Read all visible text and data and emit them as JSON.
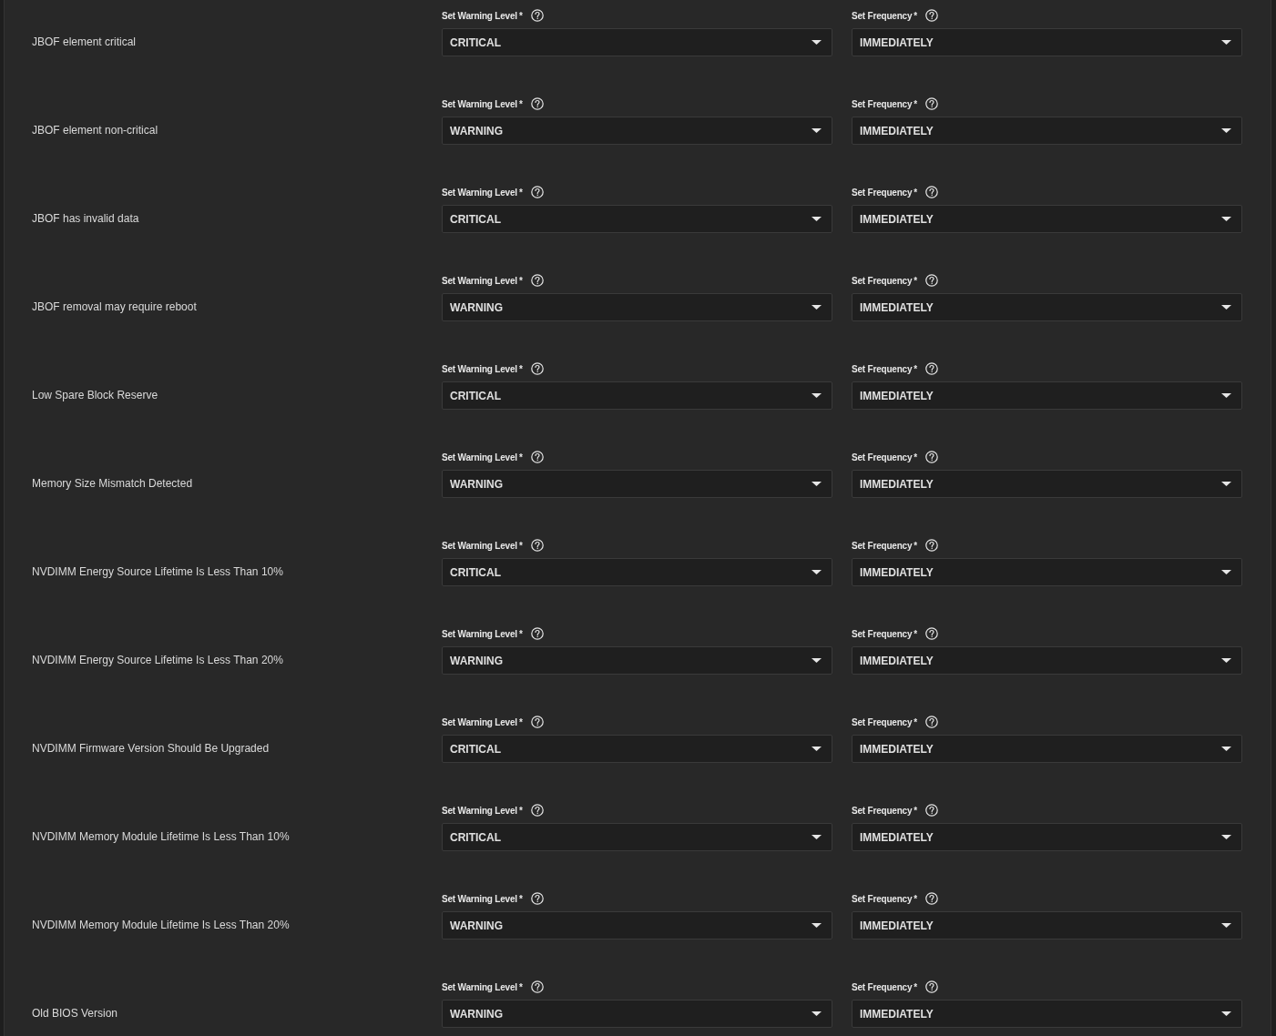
{
  "alerts": [
    {
      "name": "JBOF element critical",
      "level": {
        "label": "Set Warning Level",
        "required_mark": "*",
        "value": "CRITICAL"
      },
      "frequency": {
        "label": "Set Frequency",
        "required_mark": "*",
        "value": "IMMEDIATELY"
      }
    },
    {
      "name": "JBOF element non-critical",
      "level": {
        "label": "Set Warning Level",
        "required_mark": "*",
        "value": "WARNING"
      },
      "frequency": {
        "label": "Set Frequency",
        "required_mark": "*",
        "value": "IMMEDIATELY"
      }
    },
    {
      "name": "JBOF has invalid data",
      "level": {
        "label": "Set Warning Level",
        "required_mark": "*",
        "value": "CRITICAL"
      },
      "frequency": {
        "label": "Set Frequency",
        "required_mark": "*",
        "value": "IMMEDIATELY"
      }
    },
    {
      "name": "JBOF removal may require reboot",
      "level": {
        "label": "Set Warning Level",
        "required_mark": "*",
        "value": "WARNING"
      },
      "frequency": {
        "label": "Set Frequency",
        "required_mark": "*",
        "value": "IMMEDIATELY"
      }
    },
    {
      "name": "Low Spare Block Reserve",
      "level": {
        "label": "Set Warning Level",
        "required_mark": "*",
        "value": "CRITICAL"
      },
      "frequency": {
        "label": "Set Frequency",
        "required_mark": "*",
        "value": "IMMEDIATELY"
      }
    },
    {
      "name": "Memory Size Mismatch Detected",
      "level": {
        "label": "Set Warning Level",
        "required_mark": "*",
        "value": "WARNING"
      },
      "frequency": {
        "label": "Set Frequency",
        "required_mark": "*",
        "value": "IMMEDIATELY"
      }
    },
    {
      "name": "NVDIMM Energy Source Lifetime Is Less Than 10%",
      "level": {
        "label": "Set Warning Level",
        "required_mark": "*",
        "value": "CRITICAL"
      },
      "frequency": {
        "label": "Set Frequency",
        "required_mark": "*",
        "value": "IMMEDIATELY"
      }
    },
    {
      "name": "NVDIMM Energy Source Lifetime Is Less Than 20%",
      "level": {
        "label": "Set Warning Level",
        "required_mark": "*",
        "value": "WARNING"
      },
      "frequency": {
        "label": "Set Frequency",
        "required_mark": "*",
        "value": "IMMEDIATELY"
      }
    },
    {
      "name": "NVDIMM Firmware Version Should Be Upgraded",
      "level": {
        "label": "Set Warning Level",
        "required_mark": "*",
        "value": "CRITICAL"
      },
      "frequency": {
        "label": "Set Frequency",
        "required_mark": "*",
        "value": "IMMEDIATELY"
      }
    },
    {
      "name": "NVDIMM Memory Module Lifetime Is Less Than 10%",
      "level": {
        "label": "Set Warning Level",
        "required_mark": "*",
        "value": "CRITICAL"
      },
      "frequency": {
        "label": "Set Frequency",
        "required_mark": "*",
        "value": "IMMEDIATELY"
      }
    },
    {
      "name": "NVDIMM Memory Module Lifetime Is Less Than 20%",
      "level": {
        "label": "Set Warning Level",
        "required_mark": "*",
        "value": "WARNING"
      },
      "frequency": {
        "label": "Set Frequency",
        "required_mark": "*",
        "value": "IMMEDIATELY"
      }
    },
    {
      "name": "Old BIOS Version",
      "level": {
        "label": "Set Warning Level",
        "required_mark": "*",
        "value": "WARNING"
      },
      "frequency": {
        "label": "Set Frequency",
        "required_mark": "*",
        "value": "IMMEDIATELY"
      }
    }
  ]
}
